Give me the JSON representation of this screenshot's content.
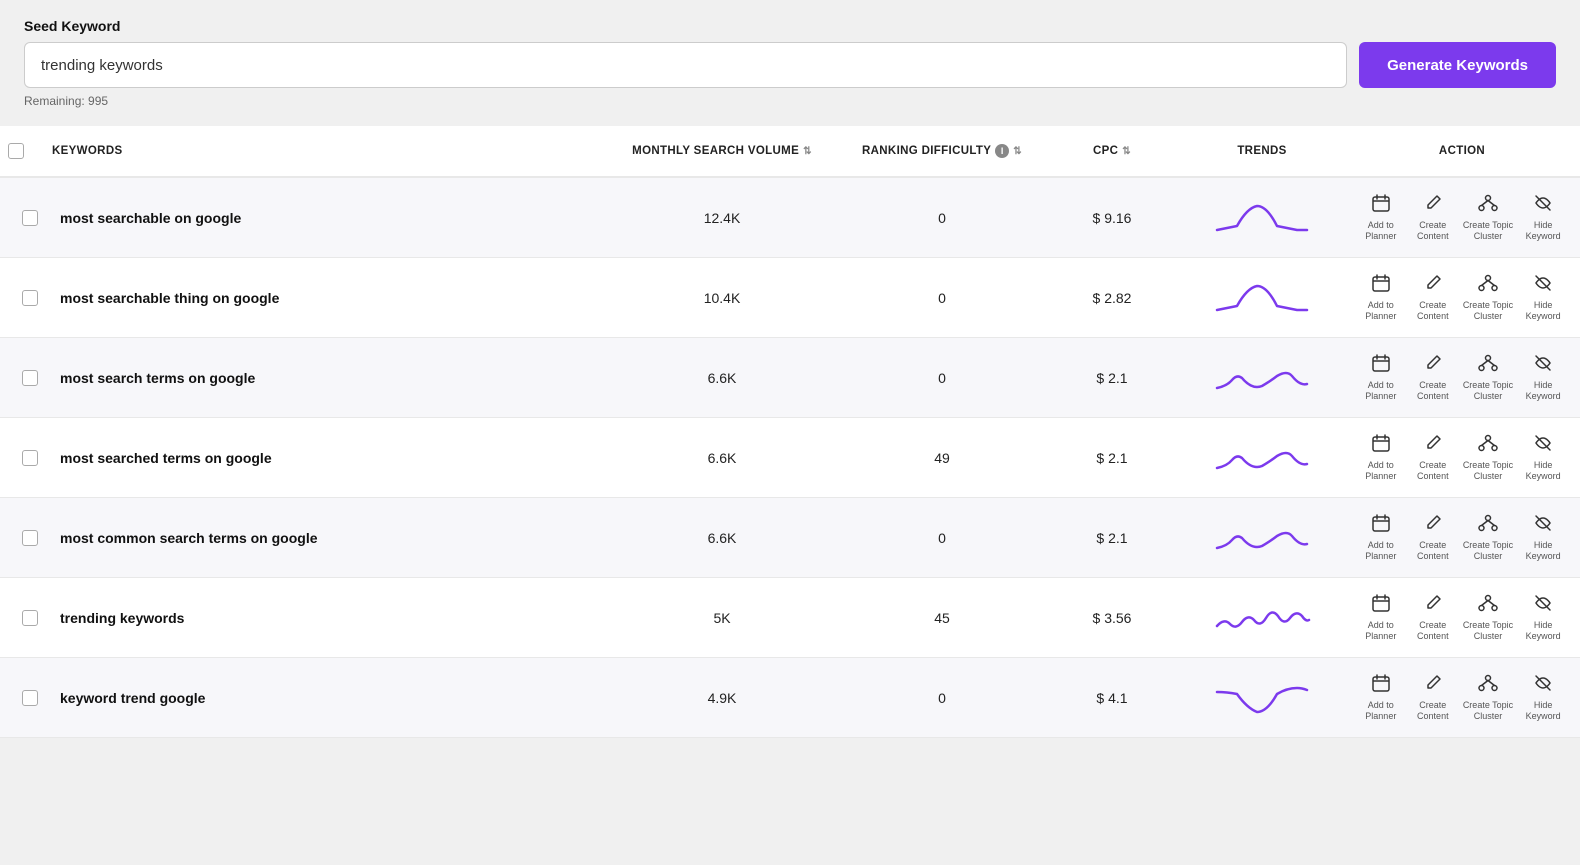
{
  "top": {
    "seed_label": "Seed Keyword",
    "input_value": "trending keywords",
    "input_placeholder": "trending keywords",
    "remaining": "Remaining: 995",
    "generate_btn": "Generate Keywords"
  },
  "table": {
    "columns": [
      {
        "id": "checkbox",
        "label": ""
      },
      {
        "id": "keywords",
        "label": "KEYWORDS"
      },
      {
        "id": "volume",
        "label": "MONTHLY SEARCH VOLUME",
        "sortable": true
      },
      {
        "id": "difficulty",
        "label": "RANKING DIFFICULTY",
        "sortable": true,
        "info": true
      },
      {
        "id": "cpc",
        "label": "CPC",
        "sortable": true
      },
      {
        "id": "trends",
        "label": "TRENDS"
      },
      {
        "id": "action",
        "label": "ACTION"
      }
    ],
    "rows": [
      {
        "keyword": "most searchable on google",
        "volume": "12.4K",
        "difficulty": "0",
        "cpc": "$ 9.16",
        "trend_type": "bell"
      },
      {
        "keyword": "most searchable thing on google",
        "volume": "10.4K",
        "difficulty": "0",
        "cpc": "$ 2.82",
        "trend_type": "bell"
      },
      {
        "keyword": "most search terms on google",
        "volume": "6.6K",
        "difficulty": "0",
        "cpc": "$ 2.1",
        "trend_type": "wave"
      },
      {
        "keyword": "most searched terms on google",
        "volume": "6.6K",
        "difficulty": "49",
        "cpc": "$ 2.1",
        "trend_type": "wave"
      },
      {
        "keyword": "most common search terms on google",
        "volume": "6.6K",
        "difficulty": "0",
        "cpc": "$ 2.1",
        "trend_type": "wave"
      },
      {
        "keyword": "trending keywords",
        "volume": "5K",
        "difficulty": "45",
        "cpc": "$ 3.56",
        "trend_type": "zigzag"
      },
      {
        "keyword": "keyword trend google",
        "volume": "4.9K",
        "difficulty": "0",
        "cpc": "$ 4.1",
        "trend_type": "valley"
      }
    ],
    "actions": [
      {
        "id": "add-planner",
        "icon": "📅",
        "label": "Add to\nPlanner"
      },
      {
        "id": "create-content",
        "icon": "✏️",
        "label": "Create\nContent"
      },
      {
        "id": "create-topic-cluster",
        "icon": "🔗",
        "label": "Create Topic\nCluster"
      },
      {
        "id": "hide-keyword",
        "icon": "🚫",
        "label": "Hide\nKeyword"
      }
    ]
  }
}
